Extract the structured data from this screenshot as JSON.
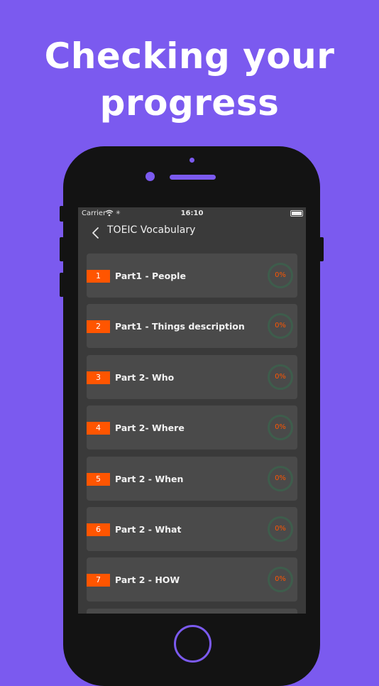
{
  "headline": {
    "line1": "Checking your",
    "line2": "progress"
  },
  "status_bar": {
    "carrier": "Carrier",
    "time": "16:10"
  },
  "nav": {
    "title": "TOEIC Vocabulary"
  },
  "lessons": [
    {
      "number": "1",
      "title": "Part1 - People",
      "progress": "0%"
    },
    {
      "number": "2",
      "title": "Part1 - Things description",
      "progress": "0%"
    },
    {
      "number": "3",
      "title": "Part 2- Who",
      "progress": "0%"
    },
    {
      "number": "4",
      "title": "Part 2- Where",
      "progress": "0%"
    },
    {
      "number": "5",
      "title": "Part 2 - When",
      "progress": "0%"
    },
    {
      "number": "6",
      "title": "Part 2 - What",
      "progress": "0%"
    },
    {
      "number": "7",
      "title": "Part 2 - HOW",
      "progress": "0%"
    }
  ],
  "colors": {
    "background": "#7B5AEF",
    "accent": "#FF5500",
    "card": "#4a4a4a",
    "ring": "#3e5d4c"
  }
}
